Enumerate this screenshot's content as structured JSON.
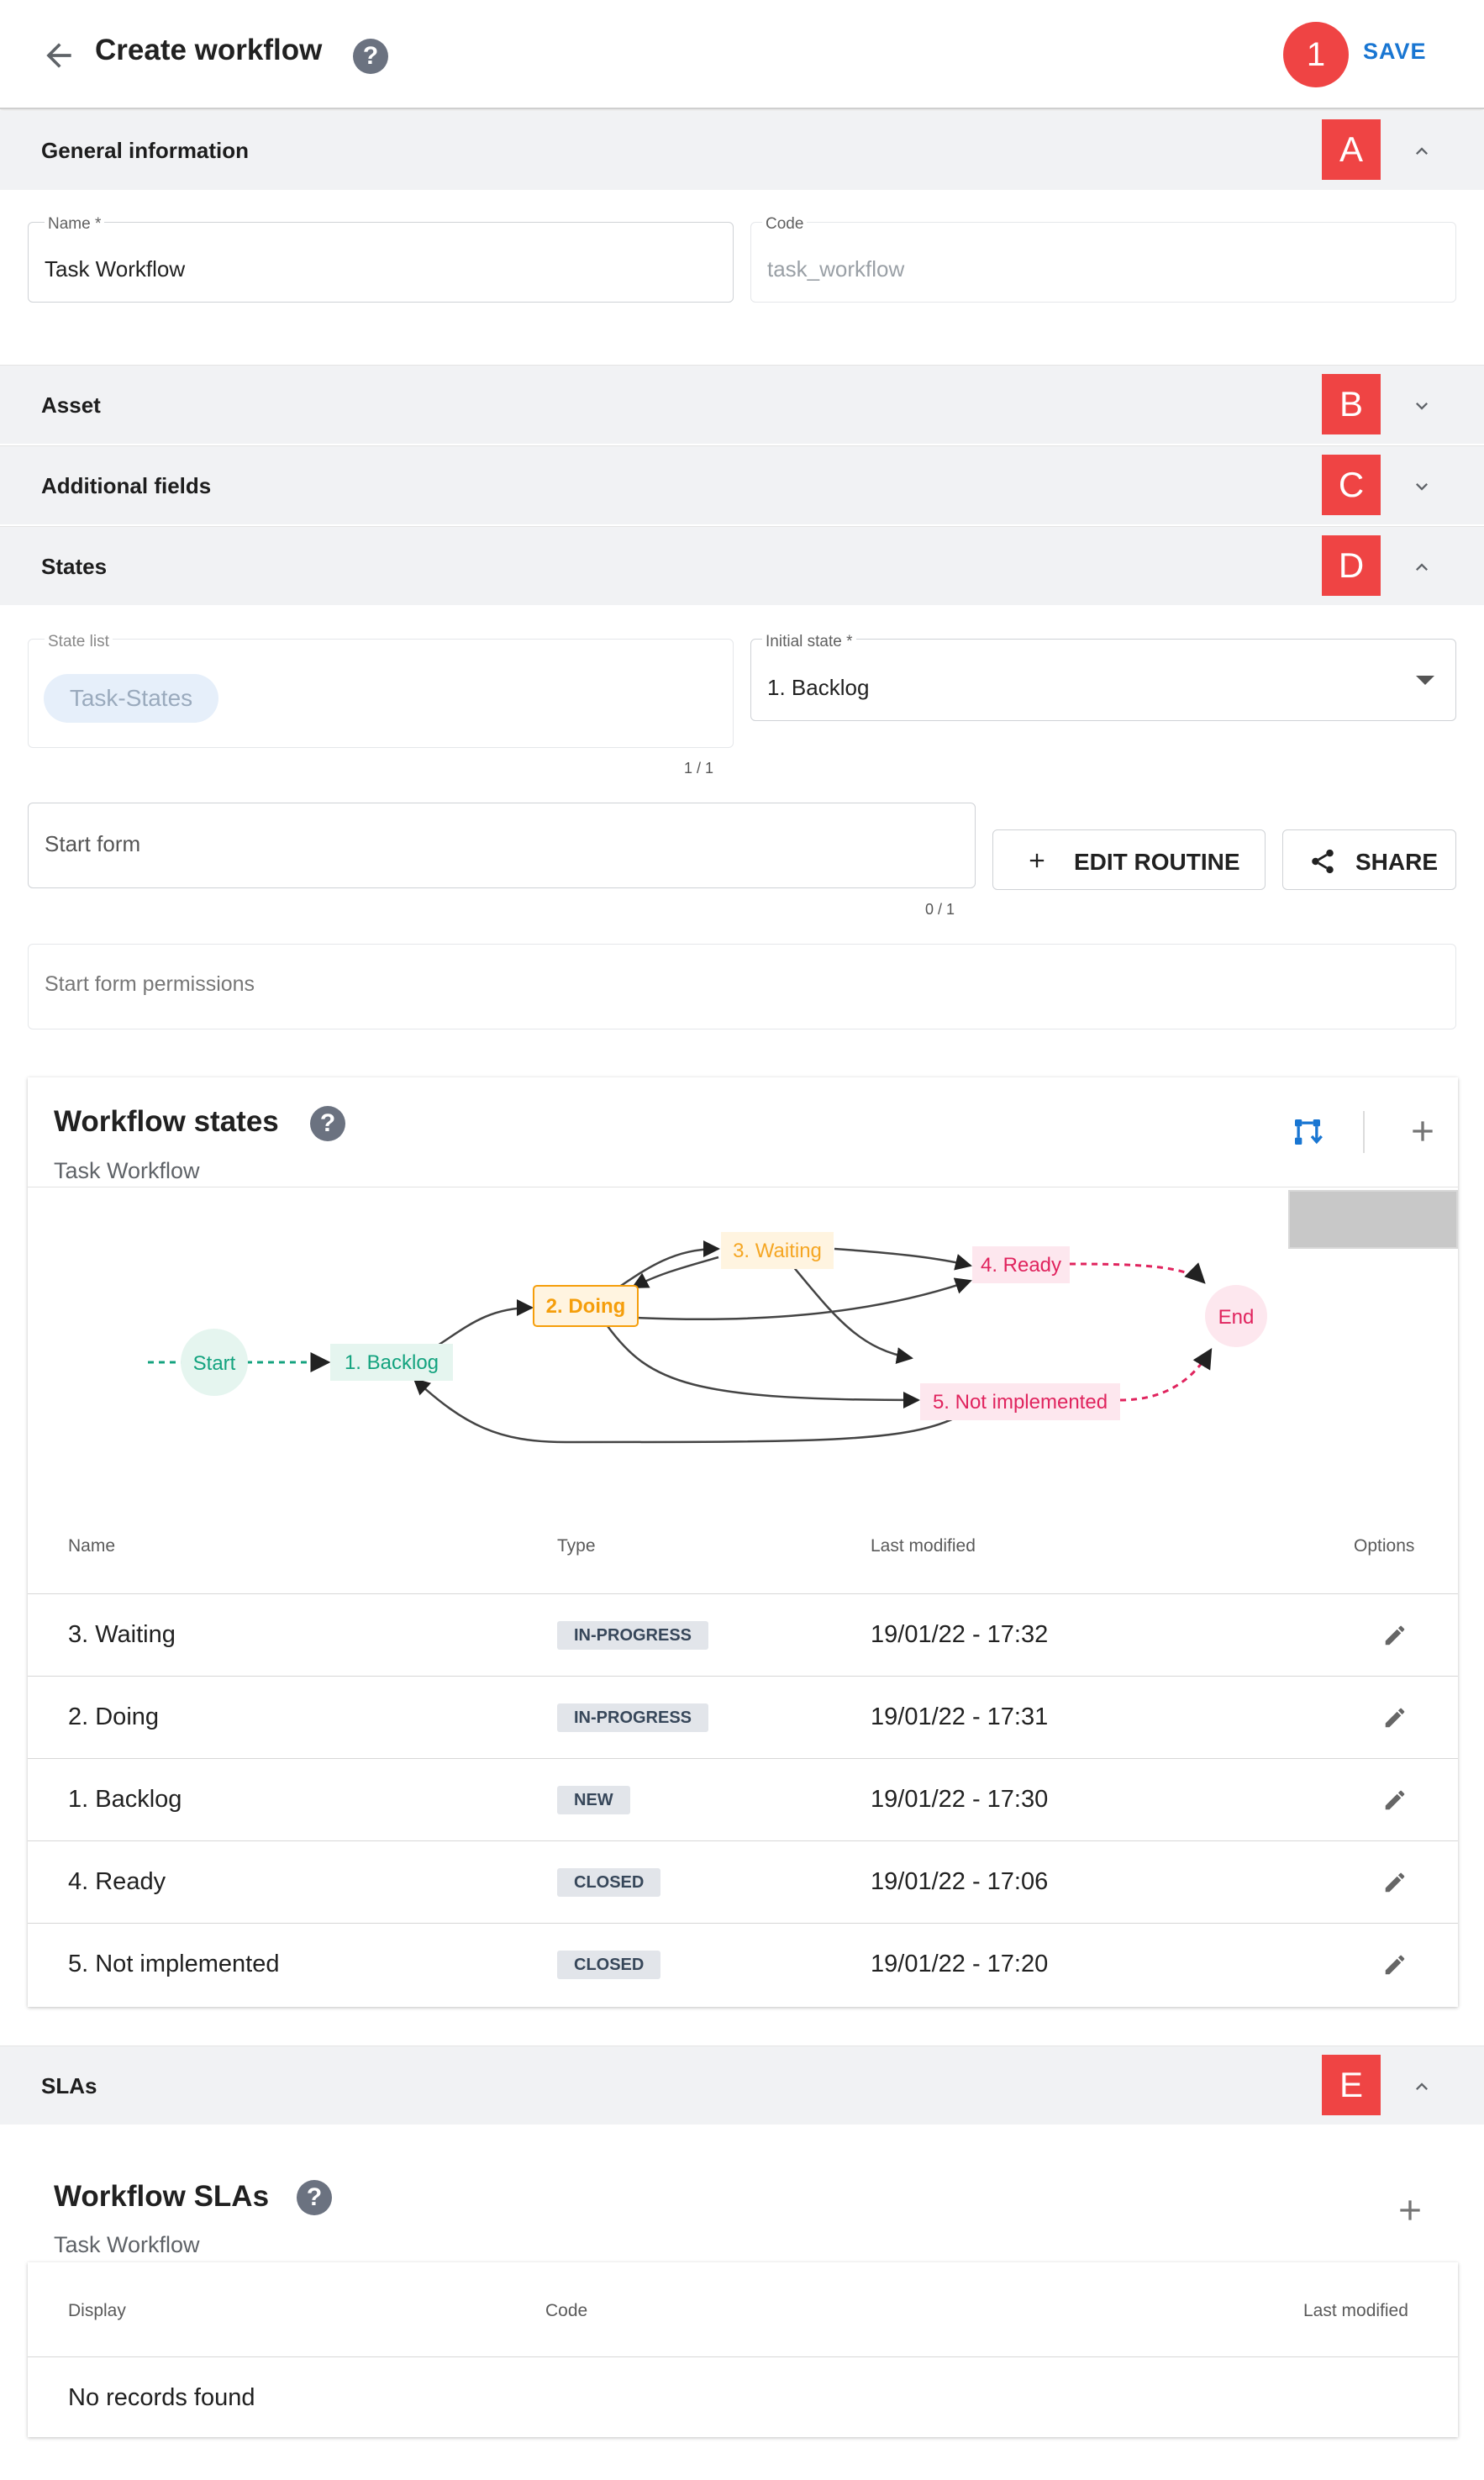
{
  "header": {
    "title": "Create workflow",
    "help_icon": "help-icon",
    "badge": "1",
    "save_label": "SAVE"
  },
  "sections": {
    "general": {
      "title": "General information",
      "badge": "A",
      "expanded": true
    },
    "asset": {
      "title": "Asset",
      "badge": "B",
      "expanded": false
    },
    "additional": {
      "title": "Additional fields",
      "badge": "C",
      "expanded": false
    },
    "states": {
      "title": "States",
      "badge": "D",
      "expanded": true
    },
    "slas": {
      "title": "SLAs",
      "badge": "E",
      "expanded": true
    }
  },
  "general": {
    "name_label": "Name *",
    "name_value": "Task Workflow",
    "code_label": "Code",
    "code_value": "task_workflow"
  },
  "states": {
    "state_list_label": "State list",
    "state_list_chip": "Task-States",
    "state_list_counter": "1 / 1",
    "initial_state_label": "Initial state *",
    "initial_state_value": "1. Backlog",
    "start_form_placeholder": "Start form",
    "start_form_counter": "0 / 1",
    "edit_routine_label": "EDIT ROUTINE",
    "share_label": "SHARE",
    "start_form_permissions_placeholder": "Start form permissions"
  },
  "workflow_states": {
    "title": "Workflow states",
    "subtitle": "Task Workflow",
    "diagram": {
      "nodes": [
        "Start",
        "1. Backlog",
        "2. Doing",
        "3. Waiting",
        "4. Ready",
        "5. Not implemented",
        "End"
      ],
      "colors": {
        "start": "#14a37f",
        "backlog": "#14a37f",
        "doing": "#f59e0b",
        "waiting": "#f5a623",
        "ready": "#e0245e",
        "not_implemented": "#e0245e",
        "end": "#e0245e"
      }
    },
    "columns": {
      "name": "Name",
      "type": "Type",
      "last_modified": "Last modified",
      "options": "Options"
    },
    "rows": [
      {
        "name": "3. Waiting",
        "type": "IN-PROGRESS",
        "last_modified": "19/01/22 - 17:32"
      },
      {
        "name": "2. Doing",
        "type": "IN-PROGRESS",
        "last_modified": "19/01/22 - 17:31"
      },
      {
        "name": "1. Backlog",
        "type": "NEW",
        "last_modified": "19/01/22 - 17:30"
      },
      {
        "name": "4. Ready",
        "type": "CLOSED",
        "last_modified": "19/01/22 - 17:06"
      },
      {
        "name": "5. Not implemented",
        "type": "CLOSED",
        "last_modified": "19/01/22 - 17:20"
      }
    ]
  },
  "workflow_slas": {
    "title": "Workflow SLAs",
    "subtitle": "Task Workflow",
    "columns": {
      "display": "Display",
      "code": "Code",
      "last_modified": "Last modified"
    },
    "empty_text": "No records found"
  }
}
